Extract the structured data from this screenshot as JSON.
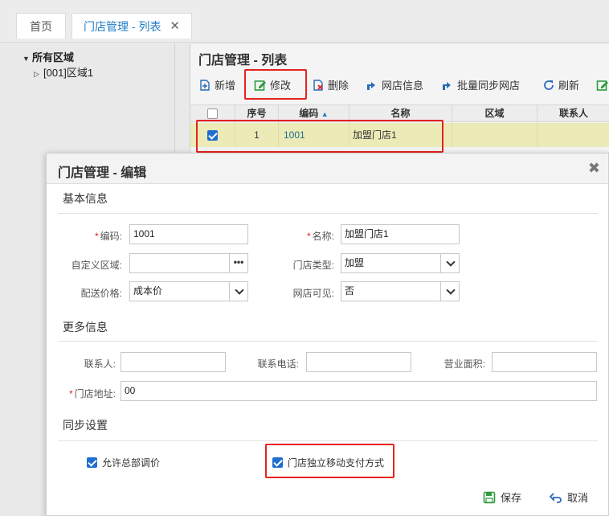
{
  "tabs": {
    "home": "首页",
    "active": "门店管理 - 列表",
    "close": "✕"
  },
  "tree": {
    "root": "所有区域",
    "child": "[001]区域1"
  },
  "grid": {
    "title": "门店管理 - 列表",
    "toolbar": {
      "add": "新增",
      "edit": "修改",
      "delete": "删除",
      "webinfo": "网店信息",
      "batch_sync": "批量同步网店",
      "refresh": "刷新"
    },
    "columns": {
      "seq": "序号",
      "code": "编码",
      "name": "名称",
      "region": "区域",
      "contact": "联系人"
    },
    "rows": [
      {
        "seq": "1",
        "code": "1001",
        "name": "加盟门店1",
        "region": "",
        "contact": ""
      }
    ]
  },
  "dialog": {
    "title": "门店管理 - 编辑",
    "close": "✖",
    "basic": {
      "section": "基本信息",
      "code_label": "编码:",
      "code_value": "1001",
      "name_label": "名称:",
      "name_value": "加盟门店1",
      "custom_region_label": "自定义区域:",
      "custom_region_value": "",
      "custom_region_btn": "•••",
      "store_type_label": "门店类型:",
      "store_type_value": "加盟",
      "price_label": "配送价格:",
      "price_value": "成本价",
      "web_visible_label": "网店可见:",
      "web_visible_value": "否"
    },
    "more": {
      "section": "更多信息",
      "contact_label": "联系人:",
      "contact_value": "",
      "phone_label": "联系电话:",
      "phone_value": "",
      "area_label": "营业面积:",
      "area_value": "",
      "address_label": "门店地址:",
      "address_value": "00"
    },
    "sync": {
      "section": "同步设置",
      "allow_price": "允许总部调价",
      "allow_price_checked": true,
      "independent_pay": "门店独立移动支付方式",
      "independent_pay_checked": true
    },
    "footer": {
      "save": "保存",
      "cancel": "取消"
    }
  },
  "colors": {
    "accent": "#1f7bc6",
    "highlight_box": "#e5221f",
    "selected_row": "#ecebb7",
    "checkbox": "#1f6fd1"
  }
}
